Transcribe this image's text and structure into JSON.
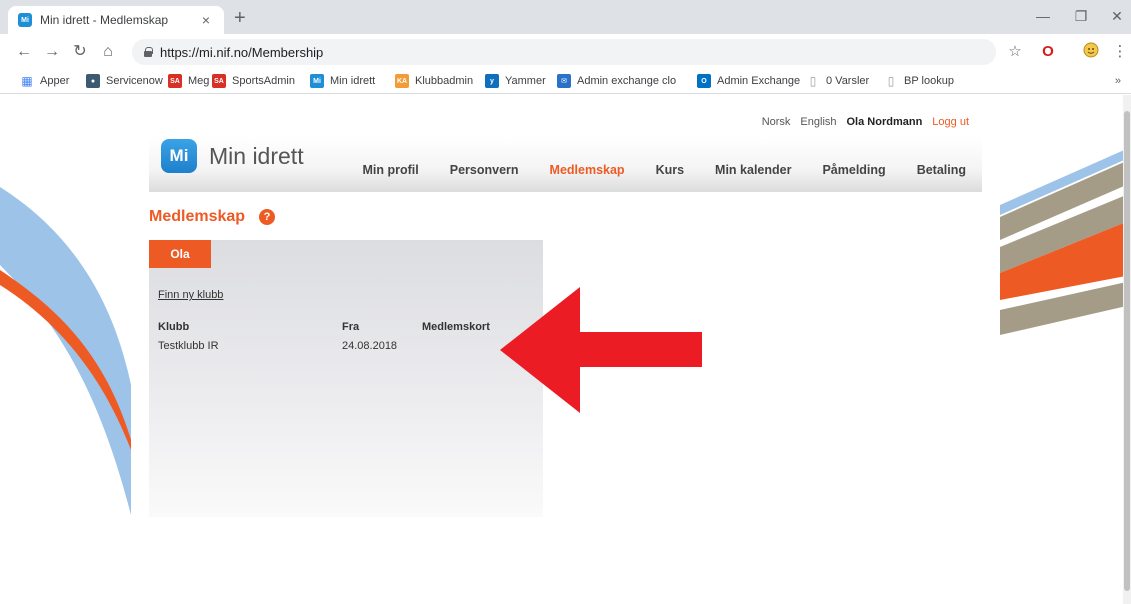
{
  "browser": {
    "tab": {
      "favicon": "Mi",
      "title": "Min idrett - Medlemskap",
      "close": "×"
    },
    "new_tab": "+",
    "window_controls": {
      "minimize": "—",
      "restore": "❐",
      "close": "✕"
    },
    "nav": {
      "back": "←",
      "forward": "→",
      "reload": "↻",
      "home": "⌂"
    },
    "url": "https://mi.nif.no/Membership",
    "toolbar_icons": {
      "star": "☆",
      "opera": "O",
      "menu": "⋮"
    },
    "bookmarks": [
      {
        "label": "Apper",
        "icon": "apps-grid-icon",
        "color": "#4285f4"
      },
      {
        "label": "Servicenow",
        "icon": "servicenow-icon",
        "color": "#3d5a73"
      },
      {
        "label": "Meg",
        "icon": "sa-icon",
        "color": "#d93025"
      },
      {
        "label": "SportsAdmin",
        "icon": "sa-icon",
        "color": "#d93025"
      },
      {
        "label": "Min idrett",
        "icon": "mi-icon",
        "color": "#1e8fd6"
      },
      {
        "label": "Klubbadmin",
        "icon": "ka-icon",
        "color": "#f29c38"
      },
      {
        "label": "Yammer",
        "icon": "yammer-icon",
        "color": "#106ebe"
      },
      {
        "label": "Admin exchange clo",
        "icon": "exchange-icon",
        "color": "#2a72c9"
      },
      {
        "label": "Admin Exchange",
        "icon": "outlook-icon",
        "color": "#0072c6"
      },
      {
        "label": "0 Varsler",
        "icon": "page-icon",
        "color": "#9aa0a6"
      },
      {
        "label": "BP lookup",
        "icon": "page-icon",
        "color": "#9aa0a6"
      }
    ],
    "bookmarks_more": "»"
  },
  "page": {
    "lang": {
      "no": "Norsk",
      "en": "English"
    },
    "user": "Ola Nordmann",
    "logout": "Logg ut",
    "logo": {
      "badge": "Mi",
      "text": "Min idrett"
    },
    "nav": [
      {
        "label": "Min profil",
        "active": false
      },
      {
        "label": "Personvern",
        "active": false
      },
      {
        "label": "Medlemskap",
        "active": true
      },
      {
        "label": "Kurs",
        "active": false
      },
      {
        "label": "Min kalender",
        "active": false
      },
      {
        "label": "Påmelding",
        "active": false
      },
      {
        "label": "Betaling",
        "active": false
      }
    ],
    "title": "Medlemskap",
    "help": "?",
    "person_tab": "Ola",
    "find_club": "Finn ny klubb",
    "table": {
      "headers": [
        "Klubb",
        "Fra",
        "Medlemskort"
      ],
      "rows": [
        [
          "Testklubb IR",
          "24.08.2018",
          ""
        ]
      ]
    },
    "accent_color": "#ee5a24",
    "arrow_color": "#ec1c24"
  }
}
